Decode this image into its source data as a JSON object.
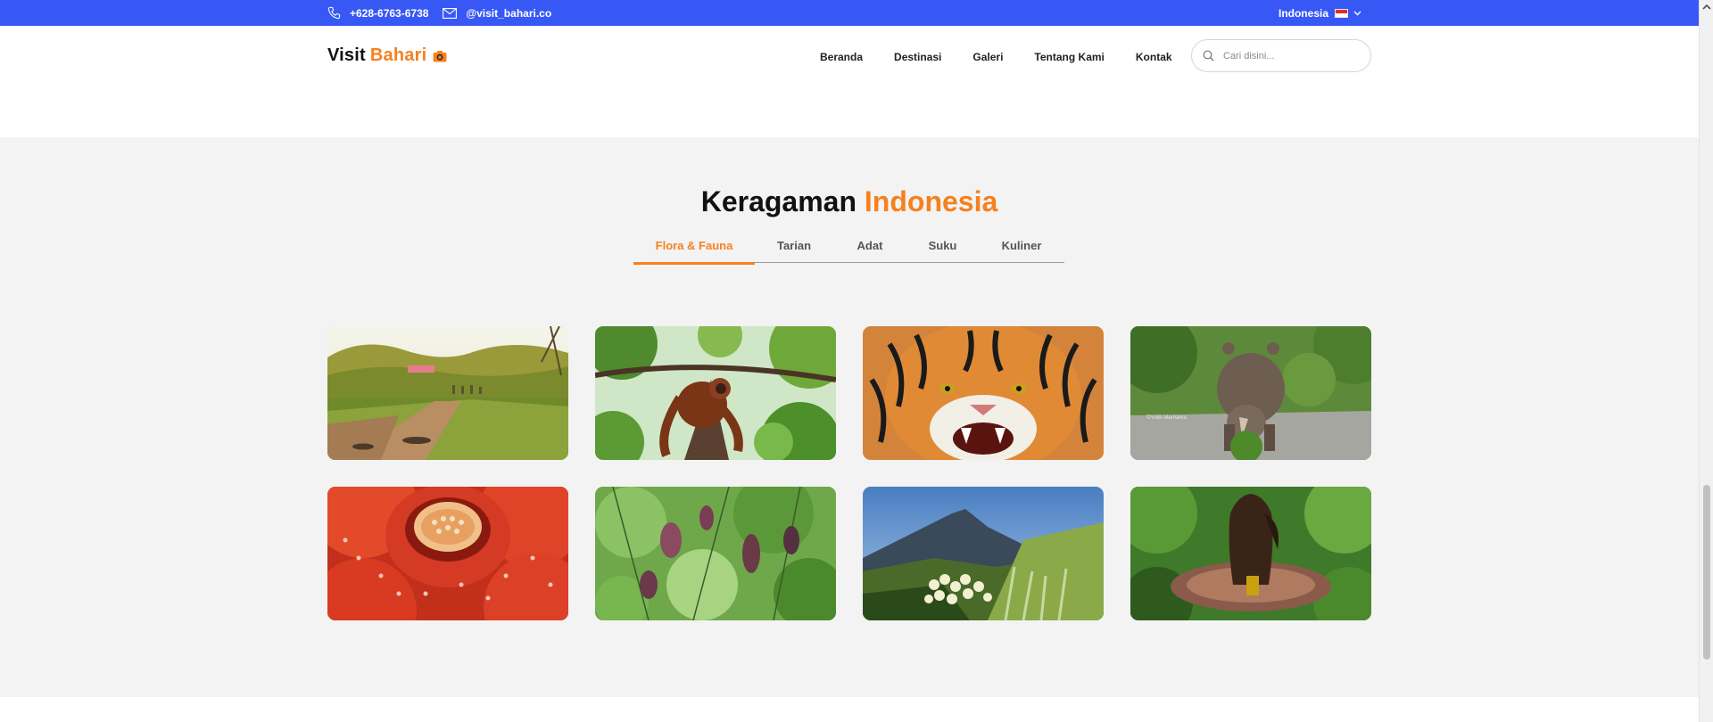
{
  "topbar": {
    "phone": "+628-6763-6738",
    "email": "@visit_bahari.co",
    "language": "Indonesia",
    "bg_color": "#3858f6"
  },
  "header": {
    "logo_prefix": "Visit",
    "logo_accent": "Bahari",
    "nav": [
      "Beranda",
      "Destinasi",
      "Galeri",
      "Tentang Kami",
      "Kontak"
    ],
    "search_placeholder": "Cari disini..."
  },
  "section": {
    "title_prefix": "Keragaman",
    "title_accent": "Indonesia",
    "tabs": [
      "Flora & Fauna",
      "Tarian",
      "Adat",
      "Suku",
      "Kuliner"
    ],
    "active_tab": "Flora & Fauna",
    "gallery": [
      {
        "subject": "komodo-savanna"
      },
      {
        "subject": "orangutan"
      },
      {
        "subject": "sumatran-tiger"
      },
      {
        "subject": "sumatran-rhino",
        "watermark": "©YABI Marhama"
      },
      {
        "subject": "rafflesia"
      },
      {
        "subject": "carnivorous-plant"
      },
      {
        "subject": "edelweiss"
      },
      {
        "subject": "corpse-flower"
      }
    ]
  },
  "colors": {
    "accent": "#f5811f",
    "topbar": "#3858f6",
    "section_bg": "#f3f3f3"
  }
}
